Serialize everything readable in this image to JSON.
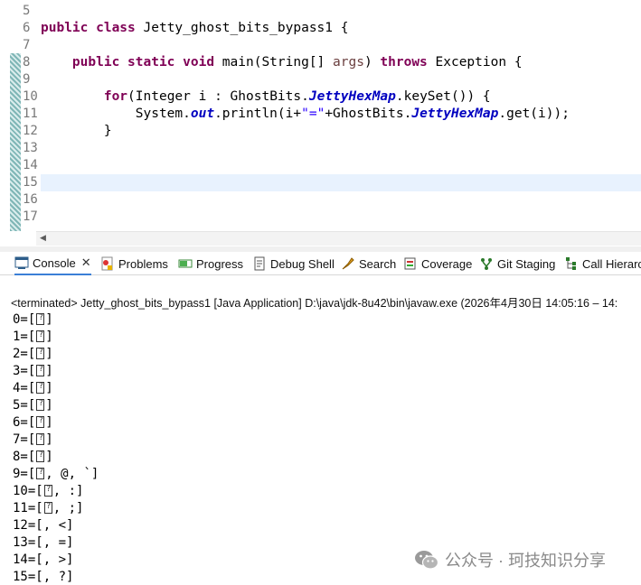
{
  "editor": {
    "lines": [
      {
        "n": "5",
        "parts": []
      },
      {
        "n": "6",
        "parts": [
          {
            "t": "public class ",
            "c": "kw"
          },
          {
            "t": "Jetty_ghost_bits_bypass1 {",
            "c": ""
          }
        ]
      },
      {
        "n": "7",
        "parts": []
      },
      {
        "n": "8",
        "parts": [
          {
            "t": "    ",
            "c": ""
          },
          {
            "t": "public static void ",
            "c": "kw"
          },
          {
            "t": "main(String[] ",
            "c": ""
          },
          {
            "t": "args",
            "c": "param"
          },
          {
            "t": ") ",
            "c": ""
          },
          {
            "t": "throws ",
            "c": "kw"
          },
          {
            "t": "Exception {",
            "c": ""
          }
        ]
      },
      {
        "n": "9",
        "parts": []
      },
      {
        "n": "10",
        "parts": [
          {
            "t": "        ",
            "c": ""
          },
          {
            "t": "for",
            "c": "kw"
          },
          {
            "t": "(Integer ",
            "c": ""
          },
          {
            "t": "i",
            "c": ""
          },
          {
            "t": " : GhostBits.",
            "c": ""
          },
          {
            "t": "JettyHexMap",
            "c": "sfld"
          },
          {
            "t": ".keySet()) {",
            "c": ""
          }
        ]
      },
      {
        "n": "11",
        "parts": [
          {
            "t": "            System.",
            "c": ""
          },
          {
            "t": "out",
            "c": "fld"
          },
          {
            "t": ".println(i+",
            "c": ""
          },
          {
            "t": "\"=\"",
            "c": "str"
          },
          {
            "t": "+GhostBits.",
            "c": ""
          },
          {
            "t": "JettyHexMap",
            "c": "sfld"
          },
          {
            "t": ".get(i));",
            "c": ""
          }
        ]
      },
      {
        "n": "12",
        "parts": [
          {
            "t": "        }",
            "c": ""
          }
        ]
      },
      {
        "n": "13",
        "parts": []
      },
      {
        "n": "14",
        "parts": []
      },
      {
        "n": "15",
        "parts": [],
        "current": true
      },
      {
        "n": "16",
        "parts": []
      },
      {
        "n": "17",
        "parts": []
      }
    ]
  },
  "tabs": [
    {
      "label": "Console",
      "icon": "console-icon",
      "active": true
    },
    {
      "label": "Problems",
      "icon": "problems-icon"
    },
    {
      "label": "Progress",
      "icon": "progress-icon"
    },
    {
      "label": "Debug Shell",
      "icon": "debug-shell-icon"
    },
    {
      "label": "Search",
      "icon": "search-icon"
    },
    {
      "label": "Coverage",
      "icon": "coverage-icon"
    },
    {
      "label": "Git Staging",
      "icon": "git-staging-icon"
    },
    {
      "label": "Call Hierarc",
      "icon": "call-hierarchy-icon"
    }
  ],
  "console": {
    "header": "<terminated> Jetty_ghost_bits_bypass1 [Java Application] D:\\java\\jdk-8u42\\bin\\javaw.exe  (2026年4月30日 14:05:16 – 14:",
    "output": [
      {
        "pre": "0=[",
        "box": true,
        "post": "]"
      },
      {
        "pre": "1=[",
        "box": true,
        "post": "]"
      },
      {
        "pre": "2=[",
        "box": true,
        "post": "]"
      },
      {
        "pre": "3=[",
        "box": true,
        "post": "]"
      },
      {
        "pre": "4=[",
        "box": true,
        "post": "]"
      },
      {
        "pre": "5=[",
        "box": true,
        "post": "]"
      },
      {
        "pre": "6=[",
        "box": true,
        "post": "]"
      },
      {
        "pre": "7=[",
        "box": true,
        "post": "]"
      },
      {
        "pre": "8=[",
        "box": true,
        "post": "]"
      },
      {
        "pre": "9=[",
        "box": true,
        "post": ", @, `]"
      },
      {
        "pre": "10=[",
        "box": true,
        "post": ", :]"
      },
      {
        "pre": "11=[",
        "box": true,
        "post": ", ;]"
      },
      {
        "pre": "12=[, <]",
        "box": false,
        "post": ""
      },
      {
        "pre": "13=[, =]",
        "box": false,
        "post": ""
      },
      {
        "pre": "14=[, >]",
        "box": false,
        "post": ""
      },
      {
        "pre": "15=[, ?]",
        "box": false,
        "post": ""
      }
    ]
  },
  "watermark": {
    "text": "公众号 · 珂技知识分享",
    "icon": "wechat-icon"
  },
  "colors": {
    "keyword": "#7f0055",
    "field": "#0000c0",
    "string": "#2a00ff",
    "current_line": "#e8f2fe"
  }
}
